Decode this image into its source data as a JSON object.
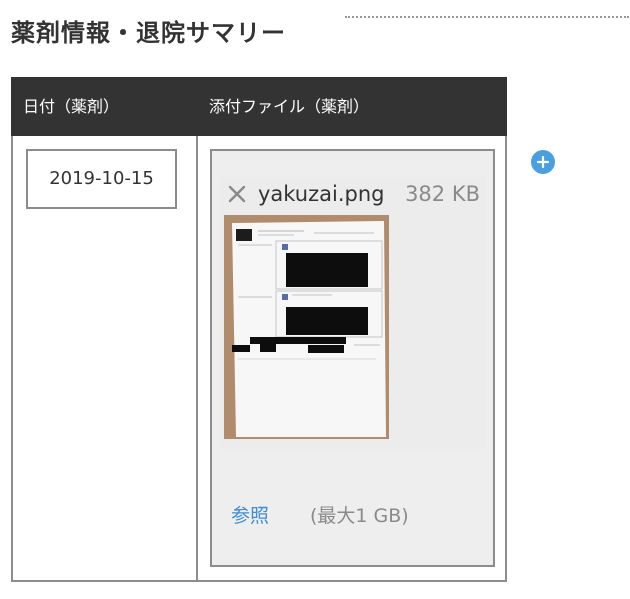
{
  "section": {
    "title": "薬剤情報・退院サマリー"
  },
  "table": {
    "headers": {
      "date": "日付（薬剤）",
      "file": "添付ファイル（薬剤）"
    },
    "row": {
      "date_value": "2019-10-15",
      "file": {
        "name": "yakuzai.png",
        "size": "382 KB",
        "remove_icon": "close-icon",
        "thumbnail": "document-photo-thumbnail"
      },
      "browse_label": "参照",
      "max_size_label": "(最大1 GB)"
    }
  },
  "actions": {
    "add_icon": "plus-circle-icon"
  },
  "colors": {
    "header_bg": "#333333",
    "link": "#3d8ed3",
    "add_button": "#4a9fe0",
    "border": "#8c8c8c",
    "drop_zone_bg": "#eeeeee"
  }
}
